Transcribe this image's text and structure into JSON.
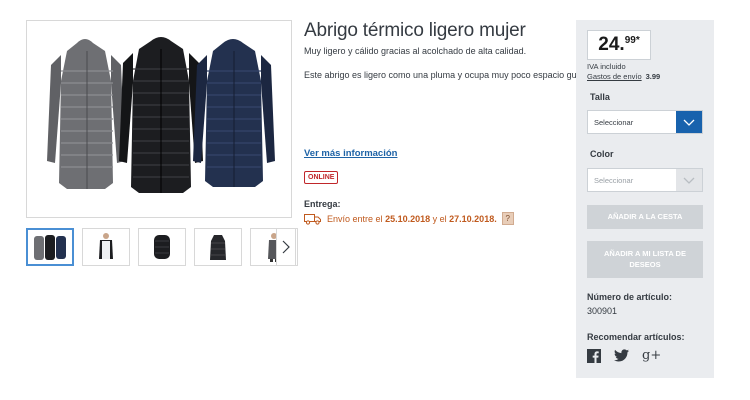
{
  "product": {
    "title": "Abrigo térmico ligero mujer",
    "subtitle": "Muy ligero y cálido gracias al acolchado de alta calidad.",
    "description": "Este abrigo es ligero como una pluma y ocupa muy poco espacio guardado.",
    "more_info_link": "Ver más información",
    "badge": "ONLINE",
    "delivery_label": "Entrega:",
    "delivery_prefix": "Envío entre el",
    "delivery_date_from": "25.10.2018",
    "delivery_middle": "y el",
    "delivery_date_to": "27.10.2018.",
    "help": "?"
  },
  "gallery": {
    "thumbnails": [
      "thumb-three-coats-icon",
      "thumb-person-front-icon",
      "thumb-folded-coat-icon",
      "thumb-black-coat-icon",
      "thumb-person-side-icon"
    ],
    "coat_colors": [
      "#6e6f73",
      "#1c1d20",
      "#23314f"
    ],
    "next": "›"
  },
  "buybox": {
    "price_int": "24.",
    "price_dec": "99*",
    "vat": "IVA incluido",
    "shipping_link": "Gastos de envío",
    "shipping_amount": "3.99",
    "size_label": "Talla",
    "size_value": "Seleccionar",
    "color_label": "Color",
    "color_value": "Seleccionar",
    "add_to_cart": "AÑADIR A LA CESTA",
    "add_to_wishlist": "AÑADIR A MI LISTA DE DESEOS",
    "article_label": "Número de artículo:",
    "article_number": "300901",
    "recommend_label": "Recomendar artículos:",
    "social": [
      "facebook-icon",
      "twitter-icon",
      "google-plus-icon"
    ],
    "google_plus": "g+"
  },
  "colors": {
    "accent_blue": "#1862ad",
    "link_blue": "#1e63a6",
    "badge_red": "#c0262a",
    "delivery_orange": "#c05a1e",
    "panel_gray": "#eaecef",
    "disabled_button": "#cfd3d7"
  }
}
